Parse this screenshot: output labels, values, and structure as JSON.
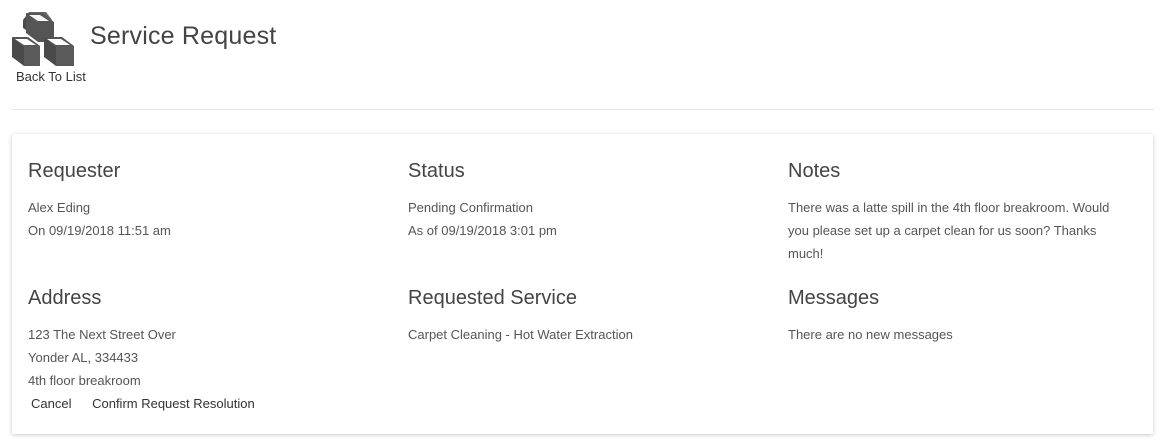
{
  "header": {
    "title": "Service Request",
    "back_label": "Back To List",
    "logo_icon": "cubes-icon"
  },
  "requester": {
    "heading": "Requester",
    "name": "Alex Eding",
    "date": "On 09/19/2018 11:51 am"
  },
  "status": {
    "heading": "Status",
    "value": "Pending Confirmation",
    "date": "As of 09/19/2018 3:01 pm"
  },
  "notes": {
    "heading": "Notes",
    "text": "There was a latte spill in the 4th floor breakroom. Would you please set up a carpet clean for us soon? Thanks much!"
  },
  "address": {
    "heading": "Address",
    "line1": "123 The Next Street Over",
    "line2": "Yonder AL, 334433",
    "line3": "4th floor breakroom"
  },
  "requested_service": {
    "heading": "Requested Service",
    "value": "Carpet Cleaning - Hot Water Extraction"
  },
  "messages": {
    "heading": "Messages",
    "value": "There are no new messages"
  },
  "actions": {
    "cancel_label": "Cancel",
    "confirm_label": "Confirm Request Resolution"
  }
}
